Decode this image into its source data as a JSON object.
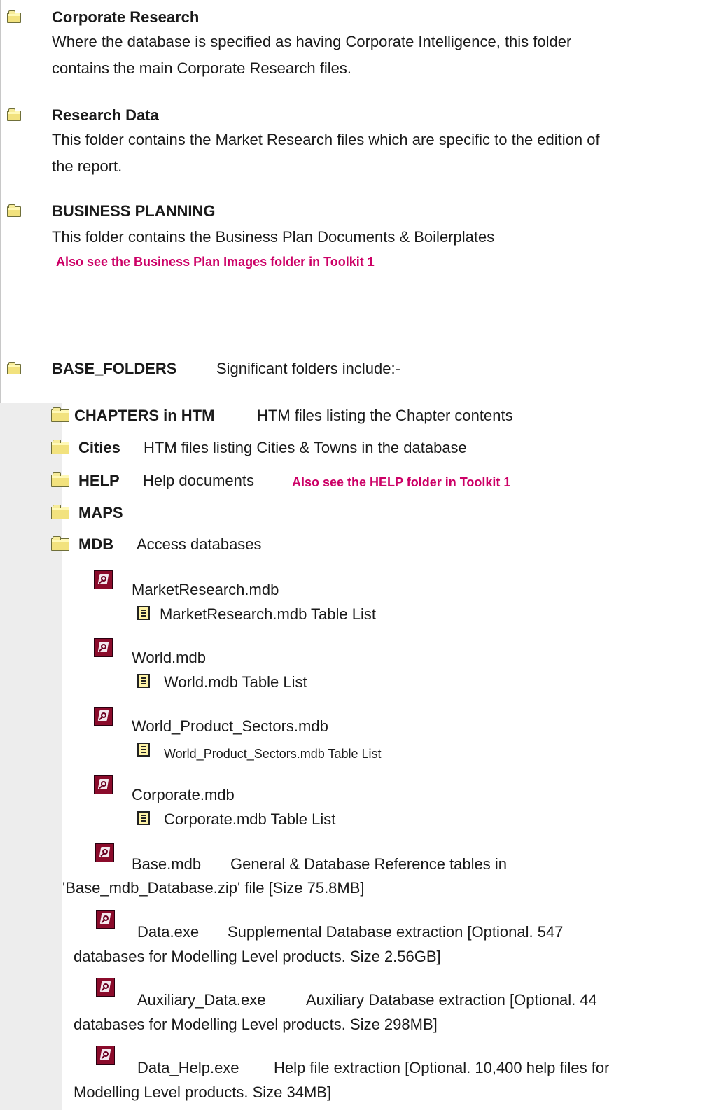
{
  "sections": {
    "corporate_research": {
      "title": "Corporate Research",
      "desc_line1": "Where the database is specified as having Corporate Intelligence, this folder",
      "desc_line2": "contains the main Corporate Research files."
    },
    "research_data": {
      "title": "Research Data",
      "desc_line1": "This folder contains the Market Research files which are specific to the edition of",
      "desc_line2": "the report."
    },
    "business_planning": {
      "title": "BUSINESS PLANNING",
      "desc": "This folder contains the Business Plan Documents & Boilerplates",
      "note": "Also see the Business Plan Images folder in Toolkit 1"
    },
    "base_folders": {
      "title": "BASE_FOLDERS",
      "desc": "Significant folders include:-"
    }
  },
  "subfolders": [
    {
      "name": "CHAPTERS in HTM",
      "desc": "HTM files listing the Chapter contents"
    },
    {
      "name": "Cities",
      "desc": "HTM files listing Cities & Towns in the database"
    },
    {
      "name": "HELP",
      "desc": "Help documents",
      "note": "Also see the HELP folder in Toolkit 1"
    },
    {
      "name": "MAPS",
      "desc": ""
    },
    {
      "name": "MDB",
      "desc": "Access databases"
    }
  ],
  "databases": [
    {
      "name": "MarketResearch.mdb",
      "table_list": "MarketResearch.mdb Table List"
    },
    {
      "name": "World.mdb",
      "table_list": "World.mdb Table List"
    },
    {
      "name": "World_Product_Sectors.mdb",
      "table_list": "World_Product_Sectors.mdb Table List"
    },
    {
      "name": "Corporate.mdb",
      "table_list": "Corporate.mdb Table List"
    }
  ],
  "extras": [
    {
      "name": "Base.mdb",
      "line1": "General & Database Reference tables in",
      "line2": "'Base_mdb_Database.zip' file [Size 75.8MB]"
    },
    {
      "name": "Data.exe",
      "line1": "Supplemental Database extraction [Optional. 547",
      "line2": "databases for Modelling Level products. Size 2.56GB]"
    },
    {
      "name": "Auxiliary_Data.exe",
      "line1": "Auxiliary Database extraction [Optional. 44",
      "line2": "databases for Modelling Level products. Size 298MB]"
    },
    {
      "name": "Data_Help.exe",
      "line1": "Help file extraction [Optional. 10,400 help files for",
      "line2": "Modelling Level products. Size 34MB]"
    }
  ]
}
